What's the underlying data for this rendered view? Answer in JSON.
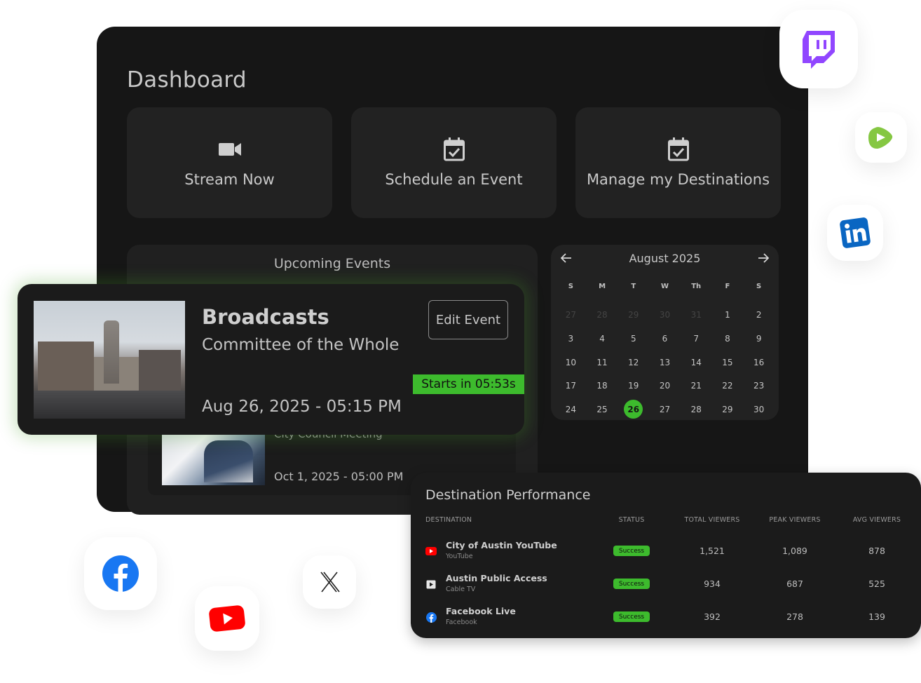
{
  "dashboard": {
    "title": "Dashboard",
    "quick_actions": [
      {
        "label": "Stream Now",
        "icon": "video-camera-icon"
      },
      {
        "label": "Schedule an Event",
        "icon": "calendar-check-icon"
      },
      {
        "label": "Manage my Destinations",
        "icon": "calendar-check-icon"
      }
    ]
  },
  "upcoming": {
    "title": "Upcoming Events",
    "featured": {
      "category": "Broadcasts",
      "name": "Committee of the Whole",
      "date": "Aug 26, 2025 - 05:15 PM",
      "edit_label": "Edit Event",
      "countdown": "Starts in 05:53s"
    },
    "second": {
      "name": "City Council Meeting",
      "date": "Oct 1, 2025 - 05:00 PM"
    }
  },
  "calendar": {
    "month": "August 2025",
    "prev_icon": "arrow-left-icon",
    "next_icon": "arrow-right-icon",
    "weekdays": [
      "S",
      "M",
      "T",
      "W",
      "Th",
      "F",
      "S"
    ],
    "days": [
      {
        "d": "27",
        "muted": true
      },
      {
        "d": "28",
        "muted": true
      },
      {
        "d": "29",
        "muted": true
      },
      {
        "d": "30",
        "muted": true
      },
      {
        "d": "31",
        "muted": true
      },
      {
        "d": "1"
      },
      {
        "d": "2"
      },
      {
        "d": "3"
      },
      {
        "d": "4"
      },
      {
        "d": "5"
      },
      {
        "d": "6"
      },
      {
        "d": "7"
      },
      {
        "d": "8"
      },
      {
        "d": "9"
      },
      {
        "d": "10"
      },
      {
        "d": "11"
      },
      {
        "d": "12"
      },
      {
        "d": "13"
      },
      {
        "d": "14"
      },
      {
        "d": "15"
      },
      {
        "d": "16"
      },
      {
        "d": "17"
      },
      {
        "d": "18"
      },
      {
        "d": "19"
      },
      {
        "d": "20"
      },
      {
        "d": "21"
      },
      {
        "d": "22"
      },
      {
        "d": "23"
      },
      {
        "d": "24"
      },
      {
        "d": "25"
      },
      {
        "d": "26",
        "selected": true
      },
      {
        "d": "27"
      },
      {
        "d": "28"
      },
      {
        "d": "29"
      },
      {
        "d": "30"
      }
    ],
    "accent": "#3dbb2d"
  },
  "performance": {
    "title": "Destination Performance",
    "headers": {
      "destination": "DESTINATION",
      "status": "STATUS",
      "total": "TOTAL VIEWERS",
      "peak": "PEAK VIEWERS",
      "avg": "AVG VIEWERS"
    },
    "rows": [
      {
        "name": "City of Austin YouTube",
        "sub": "YouTube",
        "icon": "youtube-icon",
        "status": "Success",
        "total": "1,521",
        "peak": "1,089",
        "avg": "878"
      },
      {
        "name": "Austin Public Access",
        "sub": "Cable TV",
        "icon": "tv-play-icon",
        "status": "Success",
        "total": "934",
        "peak": "687",
        "avg": "525"
      },
      {
        "name": "Facebook Live",
        "sub": "Facebook",
        "icon": "facebook-icon",
        "status": "Success",
        "total": "392",
        "peak": "278",
        "avg": "139"
      }
    ]
  },
  "socials": [
    "twitch-icon",
    "rumble-icon",
    "linkedin-icon",
    "facebook-icon",
    "youtube-icon",
    "x-icon"
  ],
  "colors": {
    "panel": "#161616",
    "card": "#222222",
    "success": "#3dbb2d"
  }
}
